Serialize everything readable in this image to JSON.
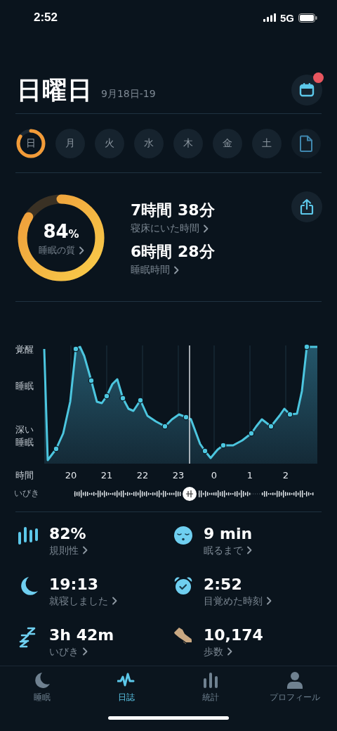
{
  "status_bar": {
    "time": "2:52",
    "network": "5G"
  },
  "header": {
    "title": "日曜日",
    "date_range": "9月18日-19",
    "calendar_has_notification": true
  },
  "days": [
    {
      "label": "日",
      "selected": true
    },
    {
      "label": "月",
      "selected": false
    },
    {
      "label": "火",
      "selected": false
    },
    {
      "label": "水",
      "selected": false
    },
    {
      "label": "木",
      "selected": false
    },
    {
      "label": "金",
      "selected": false
    },
    {
      "label": "土",
      "selected": false
    }
  ],
  "summary": {
    "quality": {
      "value": "84",
      "unit": "%",
      "label": "睡眠の質",
      "level": 0.84
    },
    "stats": [
      {
        "value": "7時間 38分",
        "label": "寝床にいた時間"
      },
      {
        "value": "6時間 28分",
        "label": "睡眠時間"
      }
    ]
  },
  "sleep_chart": {
    "y_labels": [
      "覚醒",
      "睡眠",
      "深い睡眠"
    ],
    "x_title": "時間",
    "x_labels": [
      "20",
      "21",
      "22",
      "23",
      "0",
      "1",
      "2"
    ],
    "snore_label": "いびき"
  },
  "metrics": [
    {
      "kind": "regularity",
      "value": "82%",
      "label": "規則性"
    },
    {
      "kind": "latency",
      "value": "9 min",
      "label": "眠るまで"
    },
    {
      "kind": "bedtime",
      "value": "19:13",
      "label": "就寝しました"
    },
    {
      "kind": "wake",
      "value": "2:52",
      "label": "目覚めた時刻"
    },
    {
      "kind": "snore",
      "value": "3h 42m",
      "label": "いびき"
    },
    {
      "kind": "steps",
      "value": "10,174",
      "label": "歩数"
    }
  ],
  "tabs": [
    {
      "kind": "sleep",
      "label": "睡眠",
      "selected": false
    },
    {
      "kind": "journal",
      "label": "日誌",
      "selected": true
    },
    {
      "kind": "stats",
      "label": "統計",
      "selected": false
    },
    {
      "kind": "profile",
      "label": "プロフィール",
      "selected": false
    }
  ]
}
